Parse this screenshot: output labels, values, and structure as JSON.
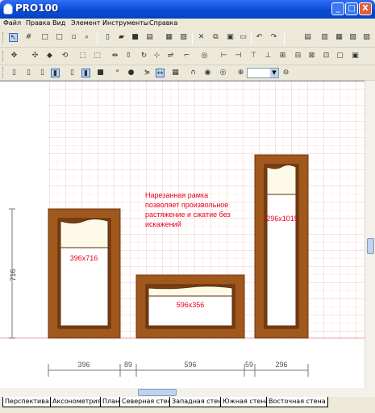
{
  "window": {
    "title": "PRO100",
    "min": "_",
    "max": "□",
    "close": "X"
  },
  "menu": [
    "Файл",
    "Правка",
    "Вид",
    "Элемент",
    "Инструменты",
    "Справка"
  ],
  "zoom": {
    "value": ""
  },
  "drawing": {
    "note": [
      "Нарезанная рамка",
      "позволяет произвольное",
      "растяжение и сжатие  без",
      "искажений"
    ],
    "height_dim": "716",
    "panels": [
      "396x716",
      "596x356",
      "296x1015"
    ],
    "dims": [
      "396",
      "89",
      "596",
      "59",
      "296"
    ]
  },
  "tabs": [
    "Перспектива",
    "Аксонометрия",
    "План",
    "Северная стена",
    "Западная стена",
    "Южная стена",
    "Восточная стена"
  ],
  "colors": {
    "grid_major": "#f4c4c4",
    "grid_minor": "#fbe6e6",
    "wood": "#a0581c",
    "wood_dark": "#6e3410",
    "note": "#e8001c"
  }
}
